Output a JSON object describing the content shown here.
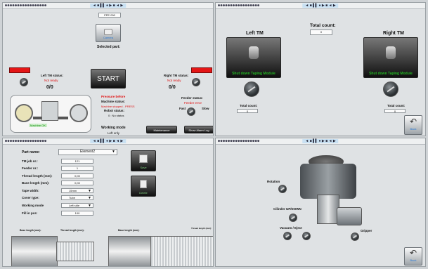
{
  "window": {
    "titlebar_dots": "●●●●●●●●●●●●●●●●●",
    "titlebar_center": "◄ ■ ▌▌ ● ▶ ■ ◄ ▶",
    "titlebar_right": "☐ — ✕"
  },
  "main": {
    "top_field": "PPE 000",
    "camera_label": "Camera",
    "selected_part_label": "Selected part:",
    "left_tm_status_label": "Left TM status:",
    "left_tm_status_value": "Not ready",
    "left_tm_count": "0/0",
    "start_label": "START",
    "right_tm_status_label": "Right TM status:",
    "right_tm_status_value": "Not ready",
    "right_tm_count": "0/0",
    "machine_ok_label": "Machine OK",
    "pressure_before": "Pressure before",
    "machine_status_label": "Machine status:",
    "machine_status_value": "Machine stopped - PRESS",
    "robot_status_label": "Robot status:",
    "robot_status_value": "0 : No status",
    "feeder_status_label": "Feeder status:",
    "feeder_status_value": "Feeder error",
    "fast_label": "Fast",
    "slow_label": "Slow",
    "working_mode_label": "Working mode",
    "working_mode_value": "Left only",
    "maintenance_button": "Maintenance",
    "alarm_log_button": "Show Alarm Log"
  },
  "taping": {
    "total_count_label": "Total count:",
    "total_count_value": "0",
    "left_tm_title": "Left TM",
    "right_tm_title": "Right TM",
    "left_shutdown": "Shut down Taping Module",
    "right_shutdown": "Shut down Taping Module",
    "left_total_label": "Total count:",
    "left_total_value": "0",
    "right_total_label": "Total count:",
    "right_total_value": "0",
    "back_label": "Back"
  },
  "settings": {
    "part_name_label": "Part name:",
    "part_name_value": "Element2",
    "tm_job_label": "TM job nr.:",
    "tm_job_value": "121",
    "feeder_label": "Feeder nr.:",
    "feeder_value": "1",
    "thread_length_label": "Thread length (mm):",
    "thread_length_value": "0,00",
    "base_length_label": "Base length (mm):",
    "base_length_value": "0,00",
    "tape_width_label": "Tape width:",
    "tape_width_value": "15mm",
    "cover_type_label": "Cover type:",
    "cover_type_value": "Tube",
    "working_mode_label": "Working mode",
    "working_mode_value": "Left side",
    "fill_label": "Fill in pcs:",
    "fill_value": "100",
    "save_label": "Save",
    "delete_label": "Delete",
    "diagram_base_left": "Base length (mm):",
    "diagram_thread_left": "Thread length (mm):",
    "diagram_base_right": "Base length (mm):",
    "diagram_thread_right": "Thread length (mm):"
  },
  "robot": {
    "rotation_label": "Rotation",
    "cilinder_label": "Cilinder UP/DOWN",
    "vacuum_label": "Vacuum  /  Eject",
    "gripper_label": "Gripper",
    "back_label": "Back"
  }
}
